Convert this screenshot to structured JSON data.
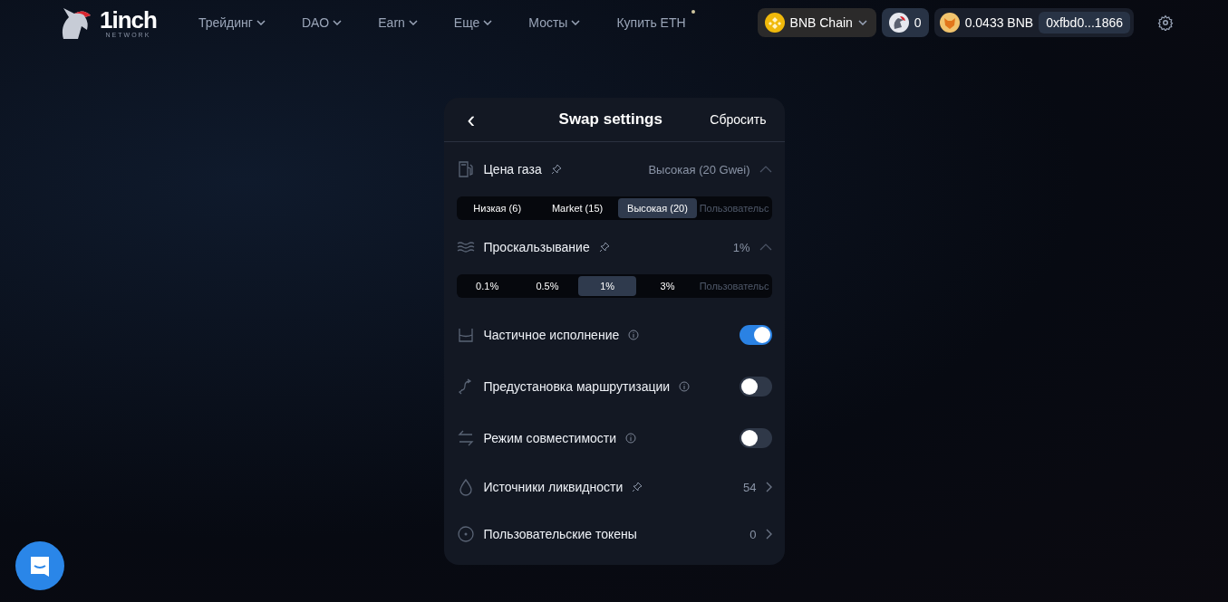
{
  "header": {
    "logo": {
      "name": "1inch",
      "sub": "NETWORK"
    },
    "nav": [
      {
        "label": "Трейдинг",
        "kind": "menu"
      },
      {
        "label": "DAO",
        "kind": "menu"
      },
      {
        "label": "Earn",
        "kind": "menu"
      },
      {
        "label": "Еще",
        "kind": "menu"
      },
      {
        "label": "Мосты",
        "kind": "menu"
      },
      {
        "label": "Купить ETH",
        "kind": "badge"
      }
    ],
    "chain": "BNB Chain",
    "points": "0",
    "balance": "0.0433 BNB",
    "address": "0xfbd0...1866"
  },
  "panel": {
    "back": "‹",
    "title": "Swap settings",
    "reset": "Сбросить",
    "sections": [
      {
        "label": "Цена газа",
        "value": "Высокая (20 Gwei)",
        "options": [
          {
            "label": "Низкая (6)",
            "selected": false
          },
          {
            "label": "Market (15)",
            "selected": false
          },
          {
            "label": "Высокая (20)",
            "selected": true
          },
          {
            "label": "Пользовательс",
            "selected": false,
            "kind": "custom"
          }
        ]
      },
      {
        "label": "Проскальзывание",
        "value": "1%",
        "options": [
          {
            "label": "0.1%",
            "selected": false
          },
          {
            "label": "0.5%",
            "selected": false
          },
          {
            "label": "1%",
            "selected": true
          },
          {
            "label": "3%",
            "selected": false
          },
          {
            "label": "Пользовательс",
            "selected": false,
            "kind": "custom"
          }
        ]
      }
    ],
    "rows": [
      {
        "kind": "toggle",
        "label": "Частичное исполнение",
        "on": true
      },
      {
        "kind": "toggle",
        "label": "Предустановка маршрутизации",
        "on": false
      },
      {
        "kind": "toggle",
        "label": "Режим совместимости",
        "on": false
      },
      {
        "kind": "pinned-link",
        "label": "Источники ликвидности",
        "value": "54"
      },
      {
        "kind": "link",
        "label": "Пользовательские токены",
        "value": "0"
      }
    ]
  }
}
